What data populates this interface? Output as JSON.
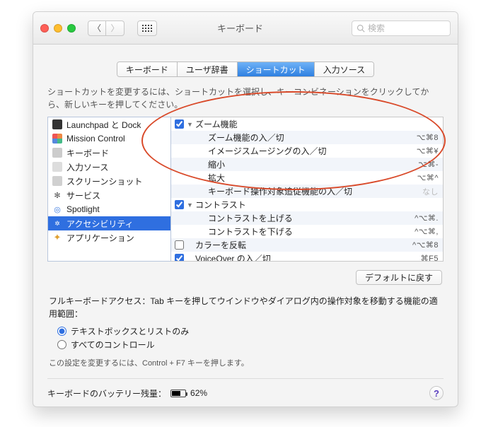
{
  "window": {
    "title": "キーボード"
  },
  "search": {
    "placeholder": "検索"
  },
  "tabs": [
    {
      "label": "キーボード"
    },
    {
      "label": "ユーザ辞書"
    },
    {
      "label": "ショートカット",
      "active": true
    },
    {
      "label": "入力ソース"
    }
  ],
  "instruction": "ショートカットを変更するには、ショートカットを選択し、キーコンビネーションをクリックしてから、新しいキーを押してください。",
  "sidebar": [
    {
      "label": "Launchpad と Dock",
      "icon": "launchpad"
    },
    {
      "label": "Mission Control",
      "icon": "mission-control"
    },
    {
      "label": "キーボード",
      "icon": "keyboard"
    },
    {
      "label": "入力ソース",
      "icon": "input-source"
    },
    {
      "label": "スクリーンショット",
      "icon": "screenshot"
    },
    {
      "label": "サービス",
      "icon": "services"
    },
    {
      "label": "Spotlight",
      "icon": "spotlight"
    },
    {
      "label": "アクセシビリティ",
      "icon": "accessibility",
      "selected": true
    },
    {
      "label": "アプリケーション",
      "icon": "application"
    }
  ],
  "shortcuts": [
    {
      "checked": true,
      "group": true,
      "label": "ズーム機能",
      "sc": ""
    },
    {
      "checked": null,
      "group": false,
      "label": "ズーム機能の入／切",
      "sc": "⌥⌘8"
    },
    {
      "checked": null,
      "group": false,
      "label": "イメージスムージングの入／切",
      "sc": "⌥⌘¥"
    },
    {
      "checked": null,
      "group": false,
      "label": "縮小",
      "sc": "⌥⌘-"
    },
    {
      "checked": null,
      "group": false,
      "label": "拡大",
      "sc": "⌥⌘^"
    },
    {
      "checked": null,
      "group": false,
      "label": "キーボード操作対象追従機能の入／切",
      "sc": "なし",
      "dim": true
    },
    {
      "checked": true,
      "group": true,
      "label": "コントラスト",
      "sc": ""
    },
    {
      "checked": null,
      "group": false,
      "label": "コントラストを上げる",
      "sc": "^⌥⌘."
    },
    {
      "checked": null,
      "group": false,
      "label": "コントラストを下げる",
      "sc": "^⌥⌘,"
    },
    {
      "checked": false,
      "group": false,
      "label": "カラーを反転",
      "sc": "^⌥⌘8",
      "top": true
    },
    {
      "checked": true,
      "group": false,
      "label": "VoiceOver の入／切",
      "sc": "⌘F5",
      "top": true
    }
  ],
  "default_btn": "デフォルトに戻す",
  "full_access": "フルキーボードアクセス：Tab キーを押してウインドウやダイアログ内の操作対象を移動する機能の適用範囲：",
  "radios": {
    "textboxes": "テキストボックスとリストのみ",
    "all": "すべてのコントロール"
  },
  "hint": "この設定を変更するには、Control + F7 キーを押します。",
  "footer": {
    "battery_label": "キーボードのバッテリー残量：",
    "battery_pct": "62%"
  }
}
